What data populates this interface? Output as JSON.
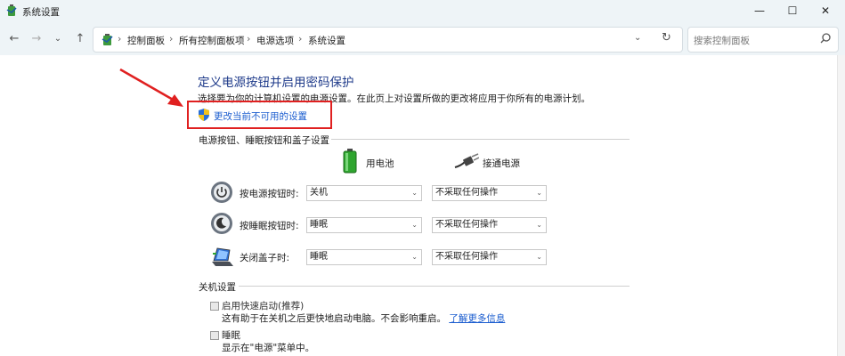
{
  "window": {
    "title": "系统设置"
  },
  "address": {
    "crumbs": [
      "控制面板",
      "所有控制面板项",
      "电源选项",
      "系统设置"
    ]
  },
  "search": {
    "placeholder": "搜索控制面板"
  },
  "main": {
    "title": "定义电源按钮并启用密码保护",
    "description": "选择要为你的计算机设置的电源设置。在此页上对设置所做的更改将应用于你所有的电源计划。",
    "change_link": "更改当前不可用的设置"
  },
  "power_section": {
    "title": "电源按钮、睡眠按钮和盖子设置",
    "columns": [
      "用电池",
      "接通电源"
    ],
    "rows": [
      {
        "label": "按电源按钮时:",
        "battery": "关机",
        "plugged": "不采取任何操作"
      },
      {
        "label": "按睡眠按钮时:",
        "battery": "睡眠",
        "plugged": "不采取任何操作"
      },
      {
        "label": "关闭盖子时:",
        "battery": "睡眠",
        "plugged": "不采取任何操作"
      }
    ]
  },
  "shutdown_section": {
    "title": "关机设置",
    "items": [
      {
        "label": "启用快速启动(推荐)",
        "desc": "这有助于在关机之后更快地启动电脑。不会影响重启。",
        "link": "了解更多信息"
      },
      {
        "label": "睡眠",
        "desc": "显示在\"电源\"菜单中。"
      }
    ]
  },
  "colors": {
    "accent": "#1e3a8a",
    "link": "#1a5ccf",
    "annotation": "#e02020"
  }
}
